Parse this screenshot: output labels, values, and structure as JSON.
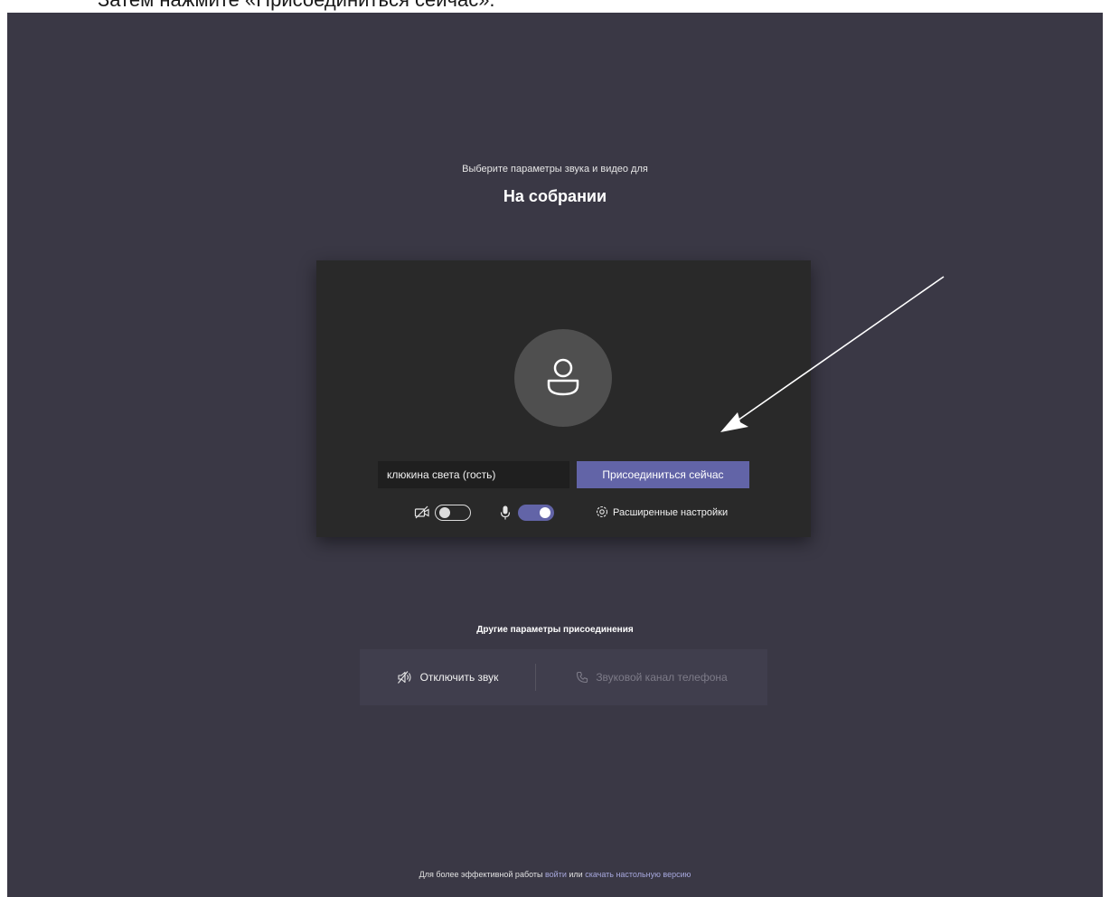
{
  "top_caption": "Затем нажмите «Присоединиться сейчас».",
  "heading": {
    "subtitle": "Выберите параметры звука и видео для",
    "title": "На собрании"
  },
  "preview": {
    "avatar_icon": "person-icon",
    "name_value": "клюкина света (гость)",
    "join_label": "Присоединиться сейчас",
    "camera": {
      "icon": "camera-off-icon",
      "on": false
    },
    "microphone": {
      "icon": "microphone-icon",
      "on": true
    },
    "settings": {
      "icon": "gear-icon",
      "label": "Расширенные настройки"
    }
  },
  "other_options": {
    "title": "Другие параметры присоединения",
    "mute": {
      "icon": "speaker-muted-icon",
      "label": "Отключить звук"
    },
    "phone": {
      "icon": "phone-icon",
      "label": "Звуковой канал телефона"
    }
  },
  "footer": {
    "prefix": "Для более эффективной работы ",
    "sign_in": "войти",
    "middle": " или ",
    "download": "скачать настольную версию"
  },
  "colors": {
    "background": "#3a3845",
    "card": "#292929",
    "accent": "#6264a7",
    "link": "#a6a7dc"
  }
}
